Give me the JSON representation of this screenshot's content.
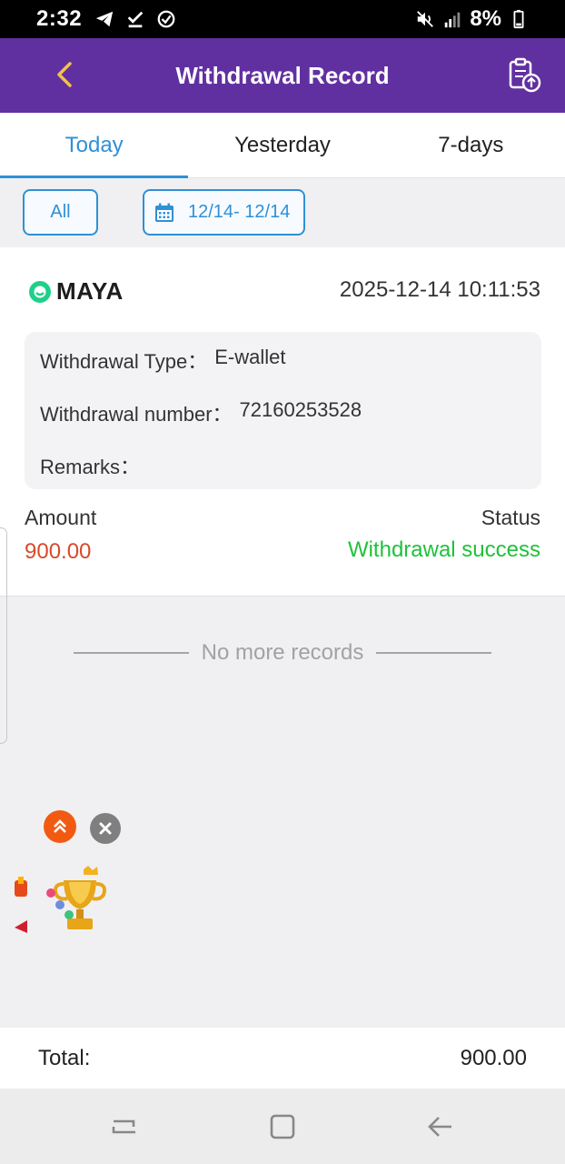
{
  "status_bar": {
    "time": "2:32",
    "battery_percent": "8%",
    "icons": [
      "telegram-icon",
      "download-done-icon",
      "check-circle-icon",
      "mute-icon",
      "lte-signal-icon",
      "battery-icon"
    ]
  },
  "header": {
    "title": "Withdrawal Record",
    "back_icon": "chevron-left-icon",
    "action_icon": "clipboard-upload-icon",
    "color": "#6130a0"
  },
  "tabs": [
    {
      "label": "Today",
      "active": true
    },
    {
      "label": "Yesterday",
      "active": false
    },
    {
      "label": "7-days",
      "active": false
    }
  ],
  "filters": {
    "all_label": "All",
    "date_range": "12/14- 12/14",
    "calendar_icon": "calendar-icon"
  },
  "record": {
    "method": "MAYA",
    "datetime": "2025-12-14 10:11:53",
    "withdrawal_type_label": "Withdrawal Type：",
    "withdrawal_type_value": "E-wallet",
    "withdrawal_number_label": "Withdrawal number：",
    "withdrawal_number_value": "72160253528",
    "remarks_label": "Remarks：",
    "remarks_value": "",
    "amount_label": "Amount",
    "amount_value": "900.00",
    "status_label": "Status",
    "status_value": "Withdrawal success",
    "amount_color": "#d84a2a",
    "status_color": "#1ec23a"
  },
  "list_end_text": "No more records",
  "footer": {
    "total_label": "Total:",
    "total_value": "900.00"
  },
  "accent_color": "#2f90d6"
}
